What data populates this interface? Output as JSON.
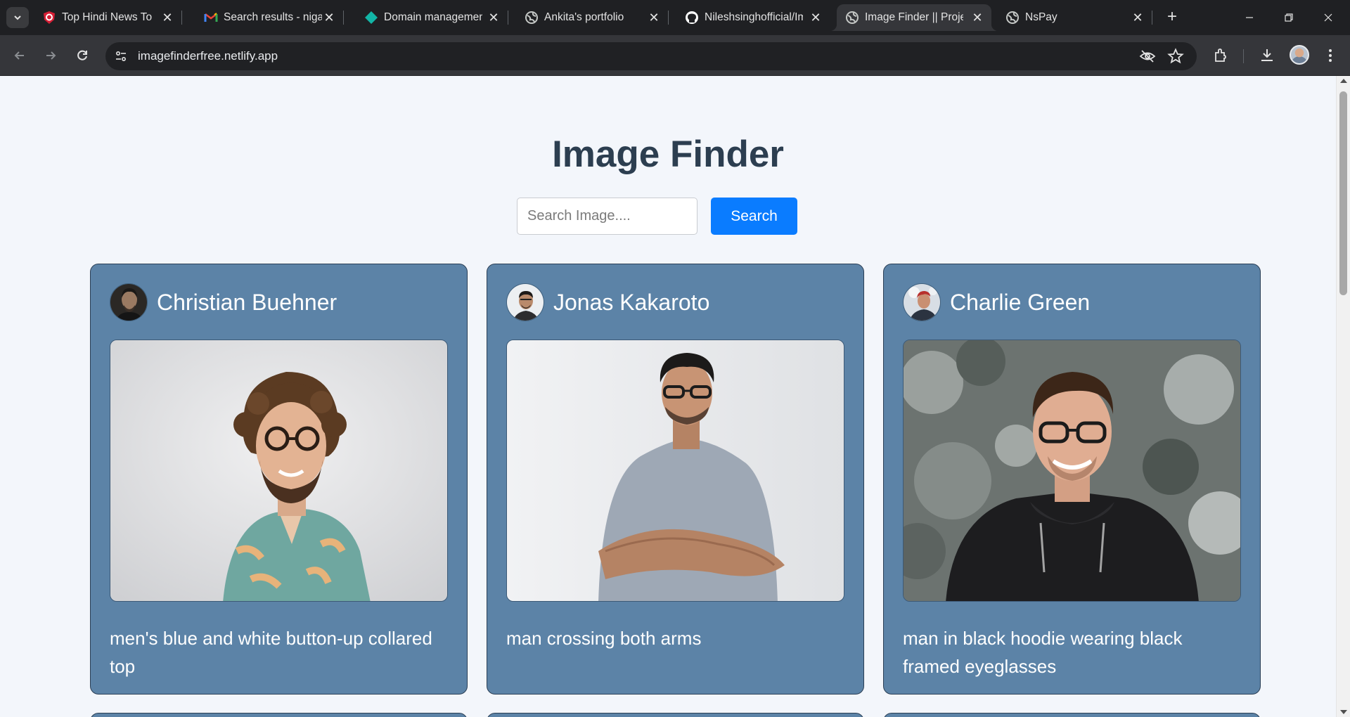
{
  "browser": {
    "tabs": [
      {
        "title": "Top Hindi News Today",
        "icon": "news-shield-icon",
        "active": false
      },
      {
        "title": "Search results - nigar",
        "icon": "gmail-icon",
        "active": false
      },
      {
        "title": "Domain management",
        "icon": "diamond-icon",
        "active": false
      },
      {
        "title": "Ankita's portfolio",
        "icon": "globe-icon",
        "active": false
      },
      {
        "title": "Nileshsinghofficial/Im",
        "icon": "github-icon",
        "active": false
      },
      {
        "title": "Image Finder || Proje",
        "icon": "globe-icon",
        "active": true
      },
      {
        "title": "NsPay",
        "icon": "globe-icon",
        "active": false
      }
    ],
    "url": "imagefinderfree.netlify.app"
  },
  "page": {
    "title": "Image Finder",
    "search": {
      "placeholder": "Search Image....",
      "value": "",
      "button_label": "Search"
    }
  },
  "cards": [
    {
      "author": "Christian Buehner",
      "description": "men's blue and white button-up collared top"
    },
    {
      "author": "Jonas Kakaroto",
      "description": "man crossing both arms"
    },
    {
      "author": "Charlie Green",
      "description": "man in black hoodie wearing black framed eyeglasses"
    }
  ],
  "colors": {
    "card_background": "#5c83a7",
    "search_button": "#0a7cff",
    "title_text": "#2c3e50",
    "page_background": "#f3f6fb"
  }
}
